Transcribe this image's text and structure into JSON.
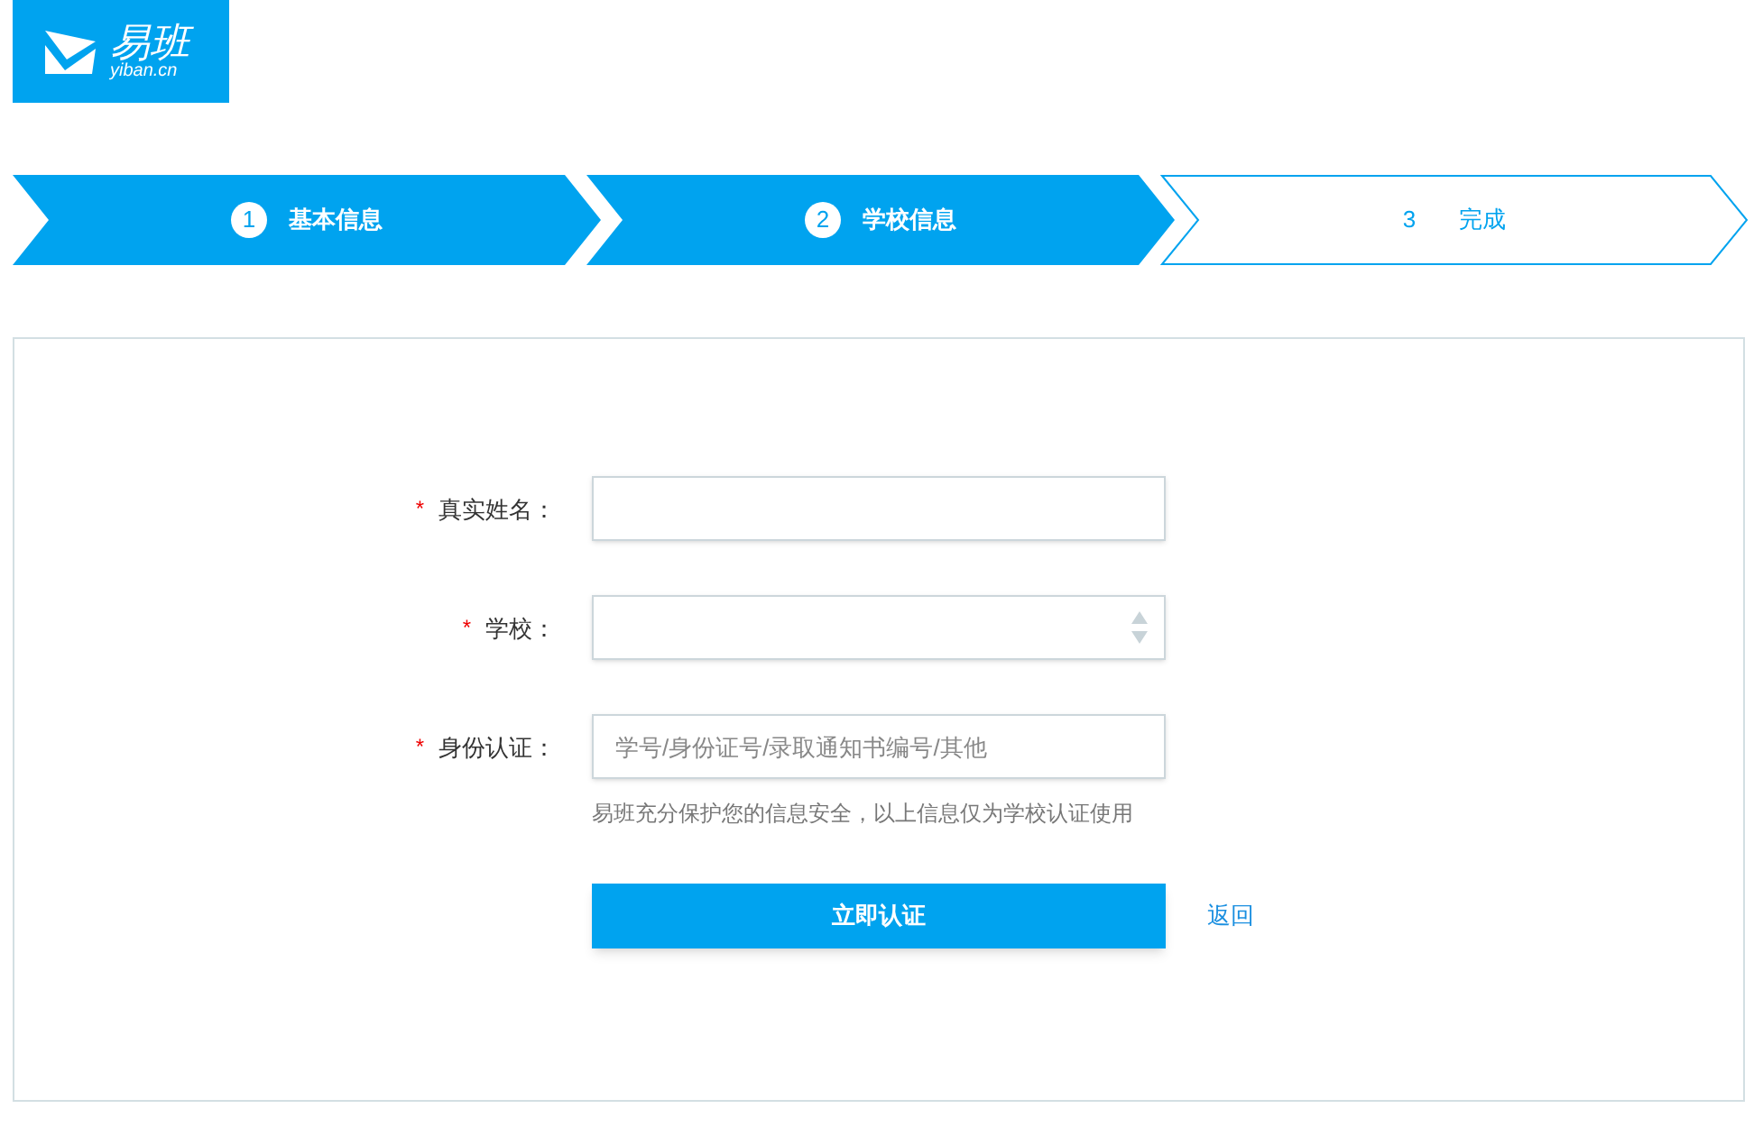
{
  "logo": {
    "name": "易班",
    "domain": "yiban.cn"
  },
  "steps": [
    {
      "number": "1",
      "label": "基本信息",
      "active": true
    },
    {
      "number": "2",
      "label": "学校信息",
      "active": true
    },
    {
      "number": "3",
      "label": "完成",
      "active": false
    }
  ],
  "form": {
    "fields": [
      {
        "kind": "text",
        "label": "真实姓名：",
        "mark": "*"
      },
      {
        "kind": "select",
        "label": "学校：",
        "mark": "*"
      },
      {
        "kind": "text",
        "label": "身份认证：",
        "mark": "*",
        "placeholder": "学号/身份证号/录取通知书编号/其他",
        "hint": "易班充分保护您的信息安全，以上信息仅为学校认证使用"
      }
    ],
    "submit": "立即认证",
    "back": "返回"
  }
}
